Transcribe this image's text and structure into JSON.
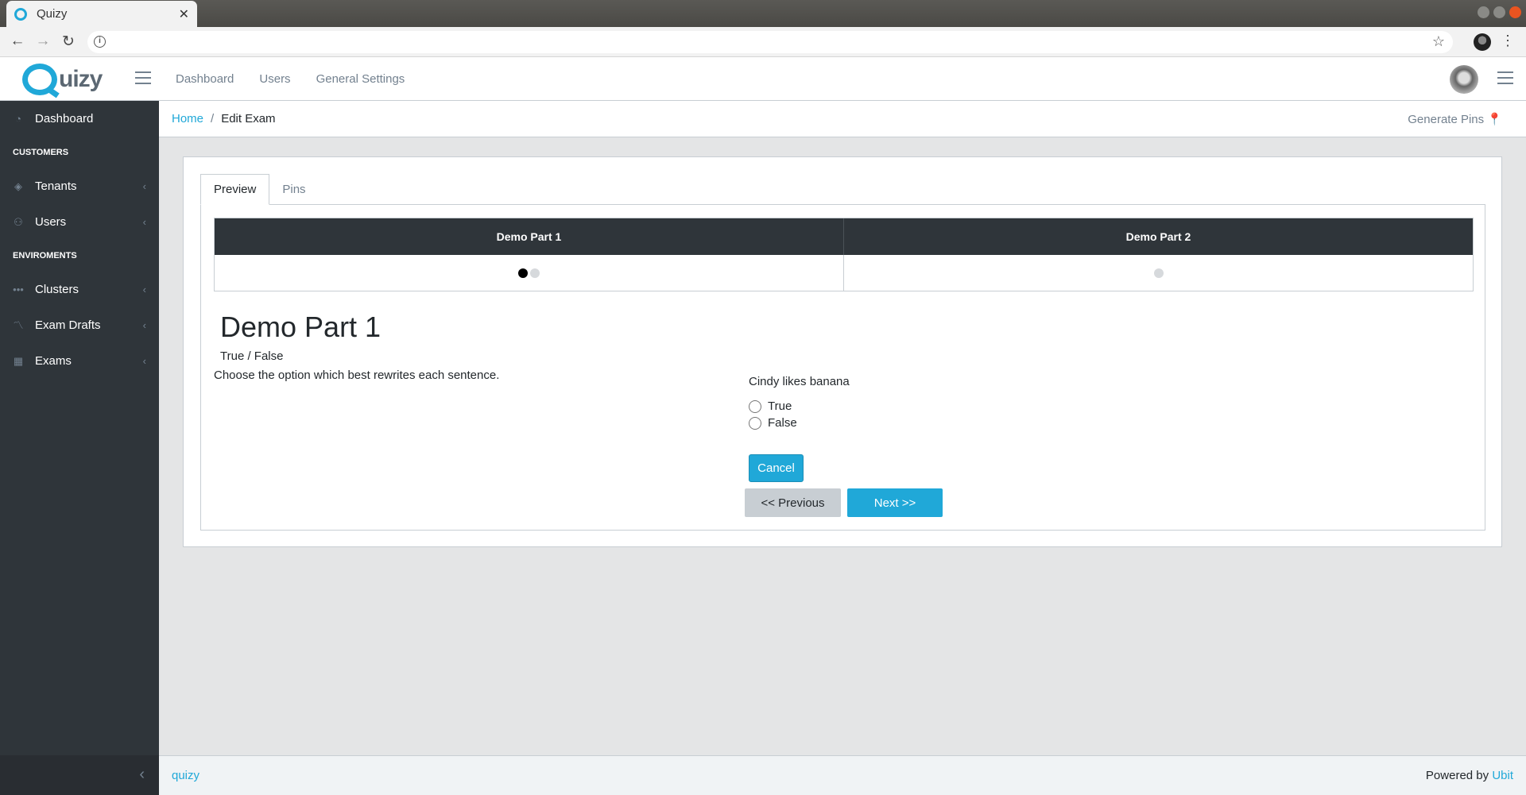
{
  "browser": {
    "tab_title": "Quizy",
    "url": ""
  },
  "header": {
    "logo_text": "uizy",
    "nav": [
      "Dashboard",
      "Users",
      "General Settings"
    ]
  },
  "sidebar": {
    "dashboard": "Dashboard",
    "section_customers": "CUSTOMERS",
    "tenants": "Tenants",
    "users": "Users",
    "section_environments": "ENVIROMENTS",
    "clusters": "Clusters",
    "exam_drafts": "Exam Drafts",
    "exams": "Exams"
  },
  "breadcrumb": {
    "home": "Home",
    "current": "Edit Exam",
    "right_action": "Generate Pins"
  },
  "tabs": [
    "Preview",
    "Pins"
  ],
  "parts": {
    "headers": [
      "Demo Part 1",
      "Demo Part 2"
    ],
    "part1_dots": 2,
    "part1_current": 1,
    "part2_dots": 1
  },
  "content": {
    "part_title": "Demo Part 1",
    "part_type": "True / False",
    "instruction": "Choose the option which best rewrites each sentence.",
    "question": "Cindy likes banana",
    "options": [
      "True",
      "False"
    ],
    "cancel_label": "Cancel",
    "prev_label": "<< Previous",
    "next_label": "Next >>"
  },
  "footer": {
    "left_link": "quizy",
    "right_prefix": "Powered by",
    "right_link": "Ubit"
  },
  "colors": {
    "accent": "#20a8d8",
    "sidebar_bg": "#2f353a",
    "page_bg": "#e4e5e6"
  }
}
